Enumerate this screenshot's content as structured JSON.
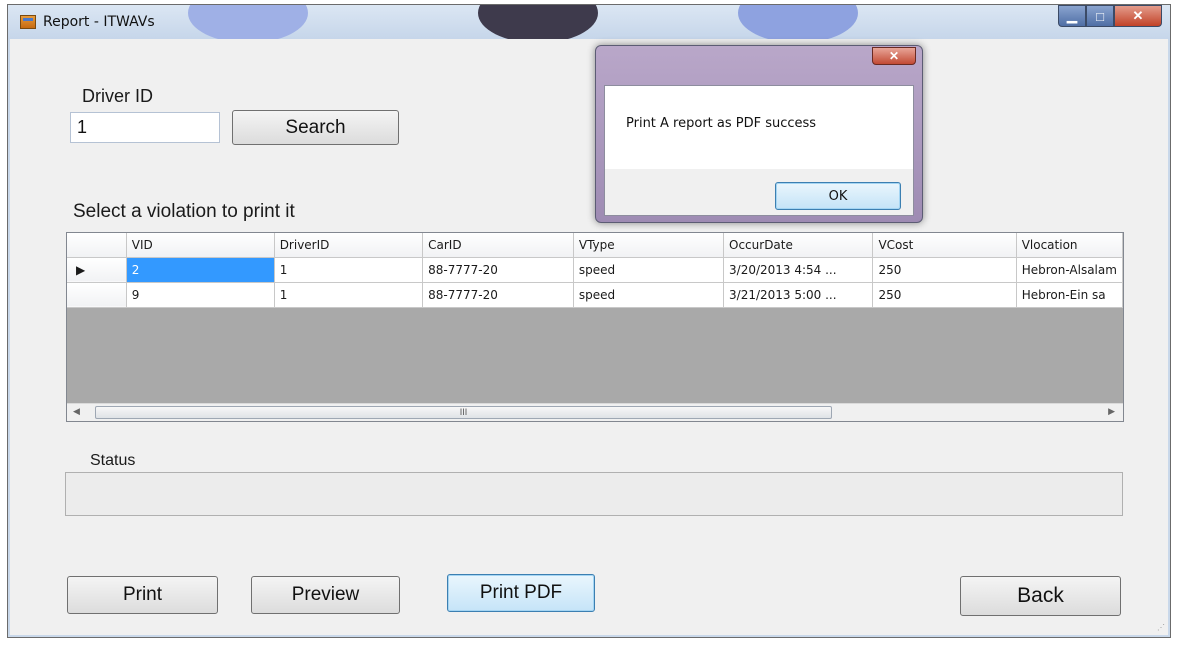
{
  "window": {
    "title": "Report - ITWAVs",
    "controls": {
      "minimize": "▁",
      "maximize": "□",
      "close": "✕"
    }
  },
  "form": {
    "driver_label": "Driver ID",
    "driver_value": "1",
    "search_label": "Search",
    "select_label": "Select a violation to print it",
    "status_label": "Status",
    "status_value": ""
  },
  "grid": {
    "columns": [
      "VID",
      "DriverID",
      "CarID",
      "VType",
      "OccurDate",
      "VCost",
      "Vlocation"
    ],
    "rows": [
      {
        "indicator": "▶",
        "cells": [
          "2",
          "1",
          "88-7777-20",
          "speed",
          "3/20/2013 4:54 ...",
          "250",
          "Hebron-Alsalam"
        ]
      },
      {
        "indicator": "",
        "cells": [
          "9",
          "1",
          "88-7777-20",
          "speed",
          "3/21/2013 5:00 ...",
          "250",
          "Hebron-Ein sa"
        ]
      }
    ],
    "scroll_left": "◀",
    "scroll_right": "▶",
    "scroll_grip": "III"
  },
  "buttons": {
    "print": "Print",
    "preview": "Preview",
    "print_pdf": "Print PDF",
    "back": "Back"
  },
  "dialog": {
    "close": "✕",
    "message": "Print A report as PDF success",
    "ok": "OK"
  },
  "colors": {
    "selection": "#3399ff",
    "grid_background": "#a9a9a9"
  }
}
